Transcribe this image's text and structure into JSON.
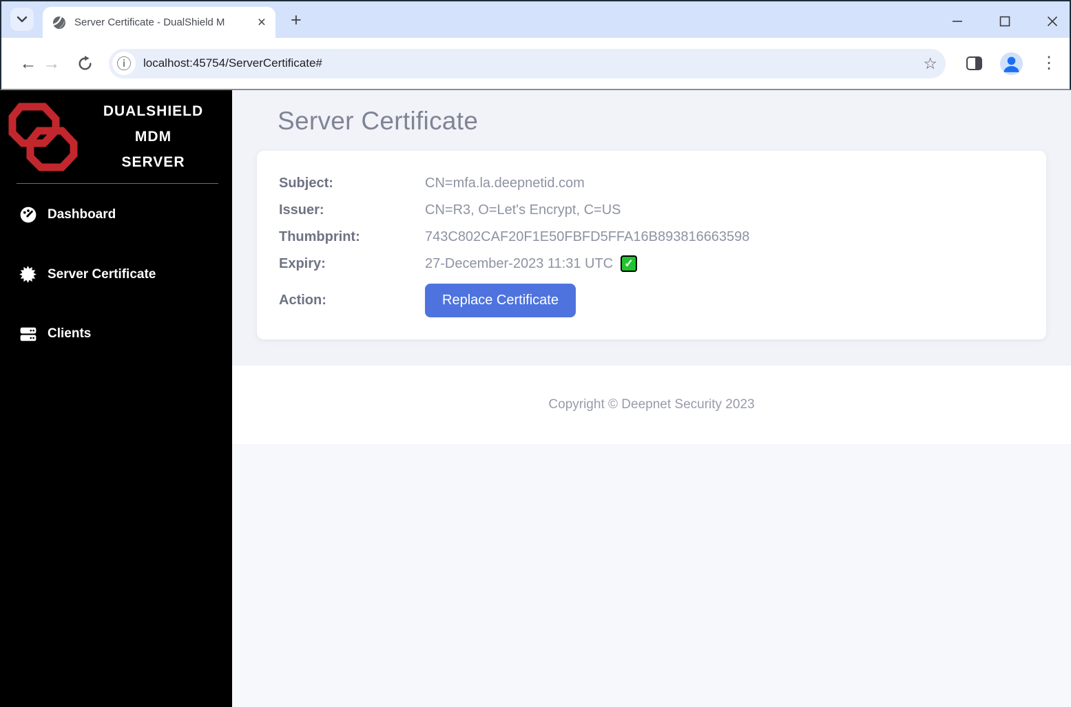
{
  "browser": {
    "tab_title": "Server Certificate - DualShield M",
    "url": "localhost:45754/ServerCertificate#"
  },
  "icons": {
    "back": "←",
    "forward": "→",
    "new_tab": "+",
    "tab_close": "×",
    "bookmark_star": "☆",
    "page_info": "ⓘ",
    "menu_kebab": "⋮",
    "check": "✓"
  },
  "sidebar": {
    "brand_line1": "DUALSHIELD",
    "brand_line2": "MDM",
    "brand_line3": "SERVER",
    "items": [
      {
        "label": "Dashboard"
      },
      {
        "label": "Server Certificate"
      },
      {
        "label": "Clients"
      }
    ]
  },
  "page": {
    "heading": "Server Certificate",
    "cert": {
      "rows": [
        {
          "label": "Subject:",
          "value": "CN=mfa.la.deepnetid.com"
        },
        {
          "label": "Issuer:",
          "value": "CN=R3, O=Let's Encrypt, C=US"
        },
        {
          "label": "Thumbprint:",
          "value": "743C802CAF20F1E50FBFD5FFA16B893816663598"
        },
        {
          "label": "Expiry:",
          "value": "27-December-2023 11:31 UTC"
        }
      ],
      "action_label": "Action:",
      "action_button": "Replace Certificate"
    },
    "footer": "Copyright © Deepnet Security 2023"
  },
  "colors": {
    "primary_button": "#4e73df",
    "brand_red": "#c2272d",
    "valid_green": "#1fc52e",
    "sidebar_bg": "#000000",
    "tabstrip_bg": "#d4e2fc",
    "content_bg": "#f1f3f9"
  }
}
